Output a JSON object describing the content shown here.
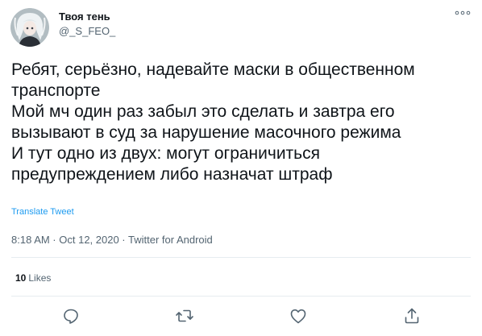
{
  "author": {
    "name": "Твоя тень",
    "handle": "@_S_FEO_",
    "avatar_icon": "anime-avatar"
  },
  "more_icon": "more-dots-icon",
  "tweet": {
    "lines": [
      "Ребят, серьёзно, надевайте маски в общественном",
      "транспорте",
      "Мой мч один раз забыл это сделать и завтра его",
      "вызывают в суд за нарушение масочного режима",
      "И тут одно из двух: могут ограничиться",
      "предупреждением либо назначат штраф"
    ],
    "translate_label": "Translate Tweet",
    "meta": "8:18 AM · Oct 12, 2020 · Twitter for Android"
  },
  "engagement": {
    "likes_count": "10",
    "likes_label": "Likes"
  },
  "actions": [
    {
      "name": "reply-icon"
    },
    {
      "name": "retweet-icon"
    },
    {
      "name": "like-icon"
    },
    {
      "name": "share-icon"
    }
  ],
  "colors": {
    "text": "#0f1419",
    "secondary": "#536471",
    "link": "#1d9bf0",
    "divider": "#e6ecf0"
  }
}
